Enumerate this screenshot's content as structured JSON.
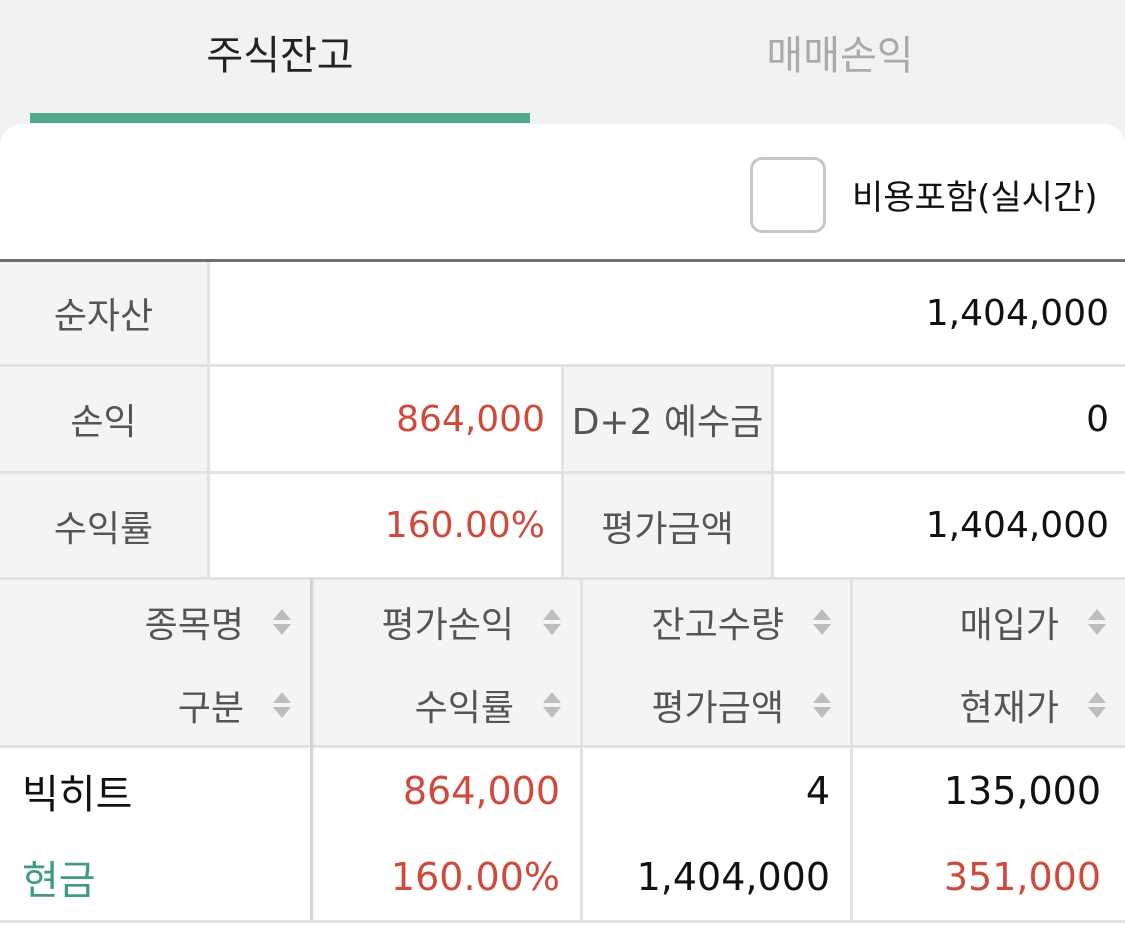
{
  "tabs": [
    {
      "label": "주식잔고",
      "active": true
    },
    {
      "label": "매매손익",
      "active": false
    }
  ],
  "accent_color": "#4fa888",
  "option": {
    "label": "비용포함(실시간)",
    "checked": false
  },
  "summary": {
    "net_assets_label": "순자산",
    "net_assets_value": "1,404,000",
    "pnl_label": "손익",
    "pnl_value": "864,000",
    "deposit_label": "D+2 예수금",
    "deposit_value": "0",
    "return_label": "수익률",
    "return_value": "160.00%",
    "eval_label": "평가금액",
    "eval_value": "1,404,000"
  },
  "holdings": {
    "headers_row1": [
      "종목명",
      "평가손익",
      "잔고수량",
      "매입가"
    ],
    "headers_row2": [
      "구분",
      "수익률",
      "평가금액",
      "현재가"
    ],
    "rows": [
      {
        "name": "빅히트",
        "type": "현금",
        "pnl": "864,000",
        "return": "160.00%",
        "qty": "4",
        "eval": "1,404,000",
        "buy_price": "135,000",
        "current_price": "351,000"
      }
    ]
  }
}
